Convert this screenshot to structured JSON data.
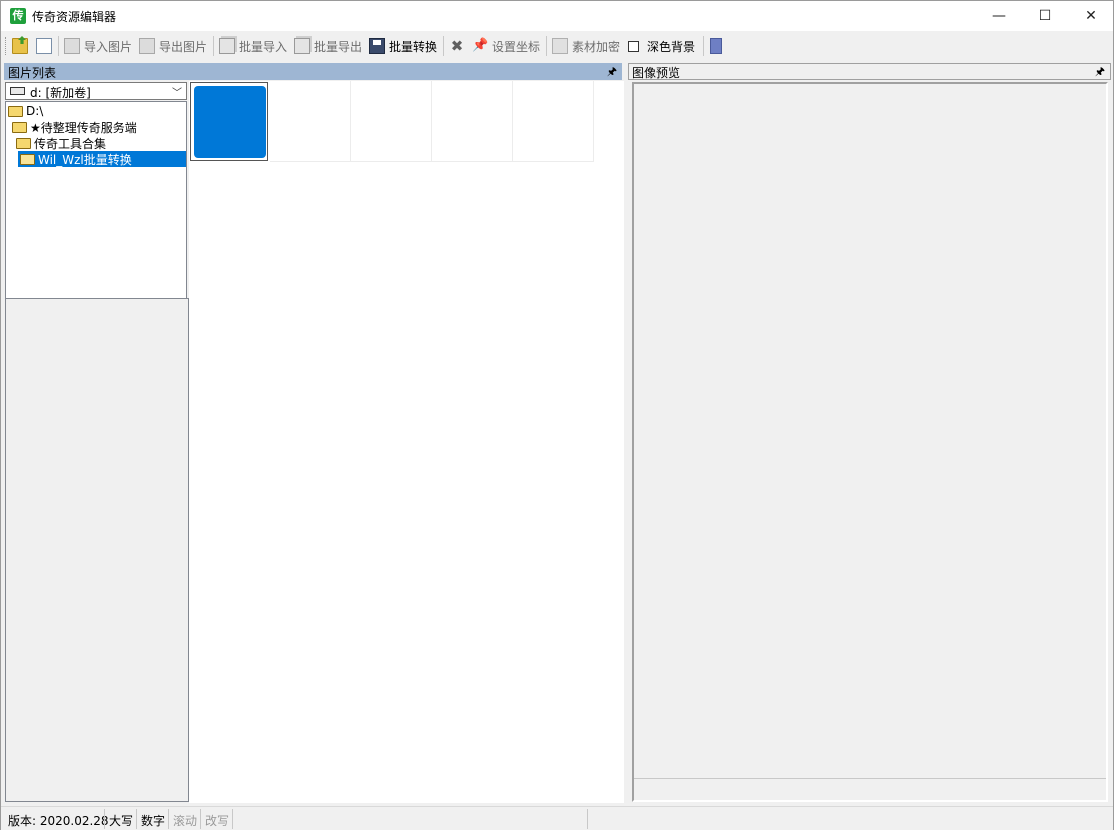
{
  "window": {
    "title": "传奇资源编辑器",
    "app_icon_glyph": "传",
    "controls": {
      "minimize": "—",
      "maximize": "☐",
      "close": "✕"
    }
  },
  "toolbar": {
    "import_image": "导入图片",
    "export_image": "导出图片",
    "batch_import": "批量导入",
    "batch_export": "批量导出",
    "batch_convert": "批量转换",
    "set_coordinates": "设置坐标",
    "material_encrypt": "素材加密",
    "dark_background": "深色背景",
    "icons": {
      "open": "open-folder-icon",
      "new": "new-file-icon",
      "delete": "delete-icon",
      "pin": "pin-icon"
    }
  },
  "left_panel": {
    "header": "图片列表",
    "pin_glyph": "🖈",
    "drive": "d: [新加卷]",
    "tree": [
      {
        "label": "D:\\",
        "selected": false
      },
      {
        "label": "★待整理传奇服务端",
        "selected": false
      },
      {
        "label": "传奇工具合集",
        "selected": false
      },
      {
        "label": "Wil_Wzl批量转换",
        "selected": true
      }
    ]
  },
  "right_panel": {
    "header": "图像预览",
    "pin_glyph": "🖈"
  },
  "thumbnails": {
    "colors": {
      "selected_fill": "#0078d7"
    },
    "count": 5
  },
  "statusbar": {
    "version": "版本: 2020.02.28",
    "caps": "大写",
    "num": "数字",
    "scroll": "滚动",
    "overwrite": "改写"
  }
}
